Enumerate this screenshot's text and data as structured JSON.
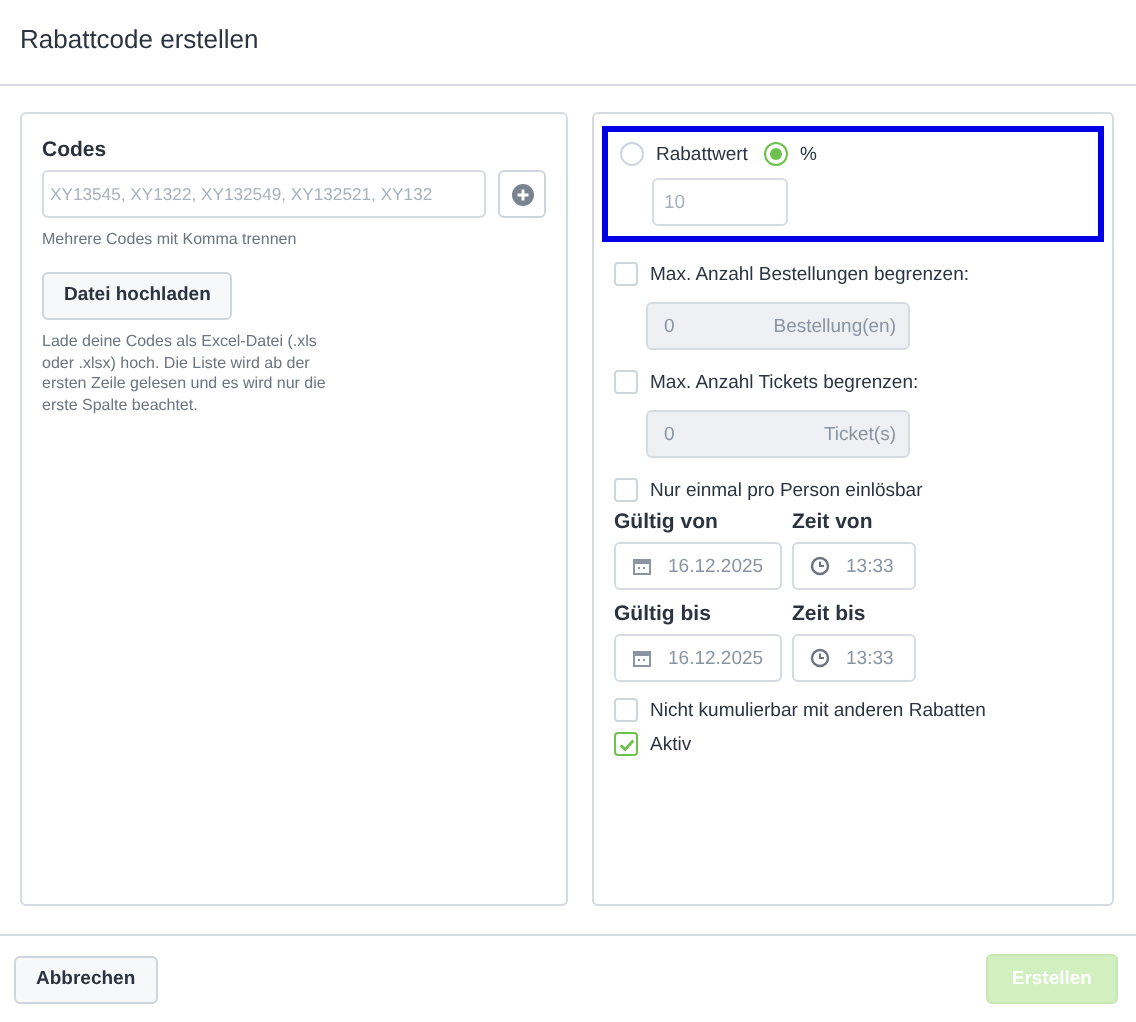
{
  "dialog": {
    "title": "Rabattcode erstellen"
  },
  "codes": {
    "label": "Codes",
    "placeholder": "XY13545, XY1322, XY132549, XY132521, XY132",
    "hint": "Mehrere Codes mit Komma trennen",
    "upload_button": "Datei hochladen",
    "upload_hint": "Lade deine Codes als Excel-Datei (.xls oder .xlsx) hoch. Die Liste wird ab der ersten Zeile gelesen und es wird nur die erste Spalte beachtet."
  },
  "discount": {
    "highlighted": true,
    "options": [
      {
        "label": "Rabattwert",
        "selected": false
      },
      {
        "label": "%",
        "selected": true
      }
    ],
    "placeholder": "10"
  },
  "limits": [
    {
      "label": "Max. Anzahl Bestellungen begrenzen:",
      "checked": false,
      "value": "0",
      "unit": "Bestellung(en)",
      "disabled": true
    },
    {
      "label": "Max. Anzahl Tickets begrenzen:",
      "checked": false,
      "value": "0",
      "unit": "Ticket(s)",
      "disabled": true
    }
  ],
  "once_per_person": {
    "label": "Nur einmal pro Person einlösbar",
    "checked": false
  },
  "validity": [
    {
      "date_label": "Gültig von",
      "date": "16.12.2025",
      "time_label": "Zeit von",
      "time": "13:33"
    },
    {
      "date_label": "Gültig bis",
      "date": "16.12.2025",
      "time_label": "Zeit bis",
      "time": "13:33"
    }
  ],
  "flags": [
    {
      "label": "Nicht kumulierbar mit anderen Rabatten",
      "checked": false
    },
    {
      "label": "Aktiv",
      "checked": true
    }
  ],
  "footer": {
    "cancel": "Abbrechen",
    "submit": {
      "label": "Erstellen",
      "disabled": true
    }
  }
}
